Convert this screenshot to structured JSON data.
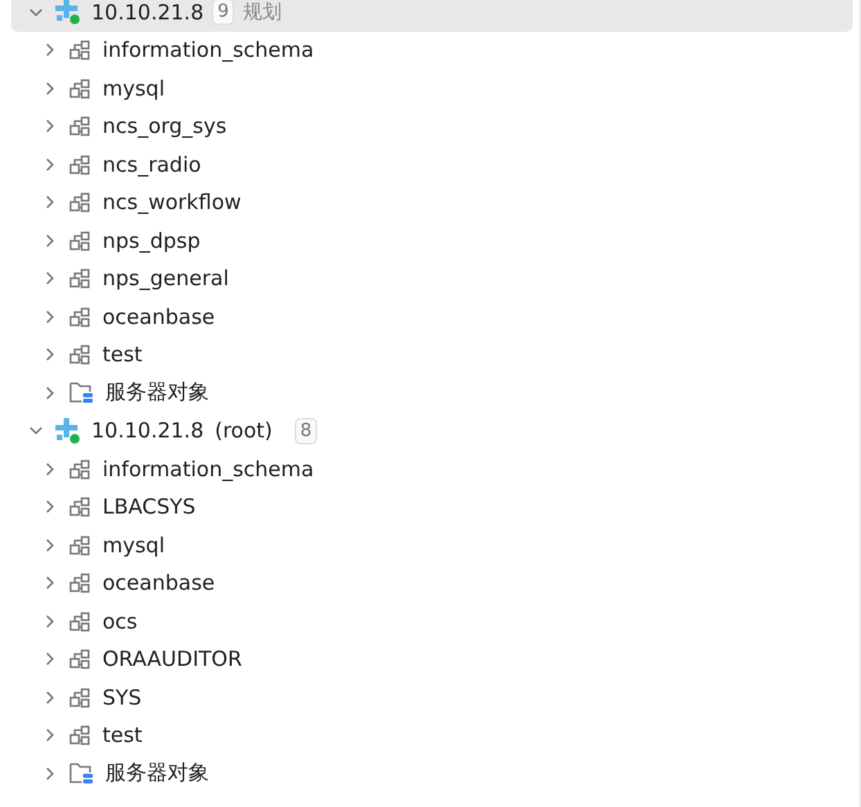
{
  "connections": [
    {
      "name": "10.10.21.8",
      "count": "9",
      "note": "规划",
      "expanded": true,
      "selected": true,
      "online": true,
      "children": [
        {
          "kind": "schema",
          "label": "information_schema"
        },
        {
          "kind": "schema",
          "label": "mysql"
        },
        {
          "kind": "schema",
          "label": "ncs_org_sys"
        },
        {
          "kind": "schema",
          "label": "ncs_radio"
        },
        {
          "kind": "schema",
          "label": "ncs_workflow"
        },
        {
          "kind": "schema",
          "label": "nps_dpsp"
        },
        {
          "kind": "schema",
          "label": "nps_general"
        },
        {
          "kind": "schema",
          "label": "oceanbase"
        },
        {
          "kind": "schema",
          "label": "test"
        },
        {
          "kind": "folder",
          "label": "服务器对象"
        }
      ]
    },
    {
      "name": "10.10.21.8",
      "user": "(root)",
      "count": "8",
      "expanded": true,
      "selected": false,
      "online": true,
      "children": [
        {
          "kind": "schema",
          "label": "information_schema"
        },
        {
          "kind": "schema",
          "label": "LBACSYS"
        },
        {
          "kind": "schema",
          "label": "mysql"
        },
        {
          "kind": "schema",
          "label": "oceanbase"
        },
        {
          "kind": "schema",
          "label": "ocs"
        },
        {
          "kind": "schema",
          "label": "ORAAUDITOR"
        },
        {
          "kind": "schema",
          "label": "SYS"
        },
        {
          "kind": "schema",
          "label": "test"
        },
        {
          "kind": "folder",
          "label": "服务器对象"
        }
      ]
    }
  ]
}
